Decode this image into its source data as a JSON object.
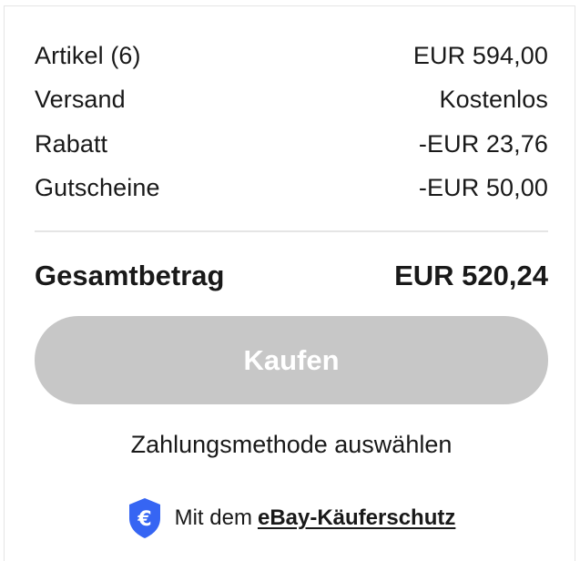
{
  "summary": {
    "rows": [
      {
        "label": "Artikel (6)",
        "value": "EUR 594,00"
      },
      {
        "label": "Versand",
        "value": "Kostenlos"
      },
      {
        "label": "Rabatt",
        "value": "-EUR 23,76"
      },
      {
        "label": "Gutscheine",
        "value": "-EUR 50,00"
      }
    ],
    "total_label": "Gesamtbetrag",
    "total_value": "EUR 520,24"
  },
  "buy_button": {
    "label": "Kaufen",
    "state": "disabled"
  },
  "payment": {
    "select_label": "Zahlungsmethode auswählen"
  },
  "buyer_protection": {
    "prefix": "Mit dem",
    "link_label": "eBay-Käuferschutz",
    "icon": "euro-shield-icon"
  },
  "colors": {
    "text": "#191919",
    "button_disabled_bg": "#c7c7c7",
    "shield_blue": "#3665f3",
    "divider": "#e5e5e5"
  }
}
